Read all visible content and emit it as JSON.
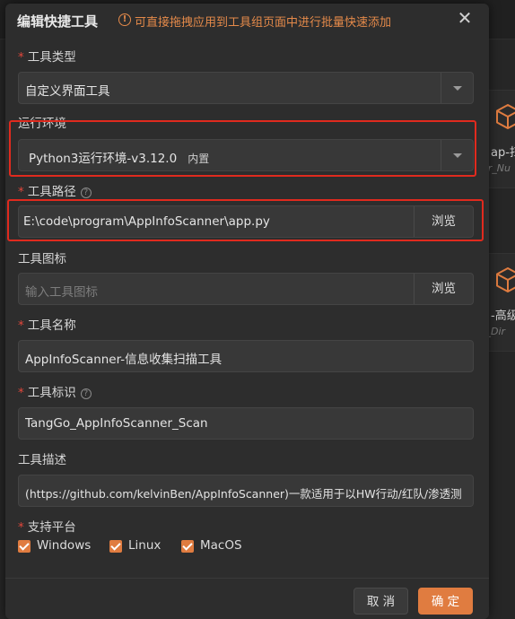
{
  "background": {
    "cards": [
      {
        "title": "ap-扫",
        "sub": "ar_Nu"
      },
      {
        "title": "-高级",
        "sub": "r_Dir"
      }
    ]
  },
  "dialog": {
    "title": "编辑快捷工具",
    "hint": "可直接拖拽应用到工具组页面中进行批量快速添加",
    "close": "✕"
  },
  "form": {
    "tool_type": {
      "label": "工具类型",
      "value": "自定义界面工具"
    },
    "runtime": {
      "label": "运行环境",
      "value": "Python3运行环境-v3.12.0",
      "tag": "内置"
    },
    "tool_path": {
      "label": "工具路径",
      "value": "E:\\code\\program\\AppInfoScanner\\app.py",
      "browse": "浏览"
    },
    "tool_icon": {
      "label": "工具图标",
      "placeholder": "输入工具图标",
      "browse": "浏览"
    },
    "tool_name": {
      "label": "工具名称",
      "value": "AppInfoScanner-信息收集扫描工具"
    },
    "tool_id": {
      "label": "工具标识",
      "value": "TangGo_AppInfoScanner_Scan"
    },
    "tool_desc": {
      "label": "工具描述",
      "value": "(https://github.com/kelvinBen/AppInfoScanner)一款适用于以HW行动/红队/渗透测"
    },
    "platforms": {
      "label": "支持平台",
      "options": [
        {
          "label": "Windows",
          "checked": true
        },
        {
          "label": "Linux",
          "checked": true
        },
        {
          "label": "MacOS",
          "checked": true
        }
      ]
    }
  },
  "footer": {
    "cancel": "取 消",
    "ok": "确 定"
  },
  "colors": {
    "accent": "#e07c40",
    "highlight": "#e02a1e",
    "required": "#e2473b"
  }
}
